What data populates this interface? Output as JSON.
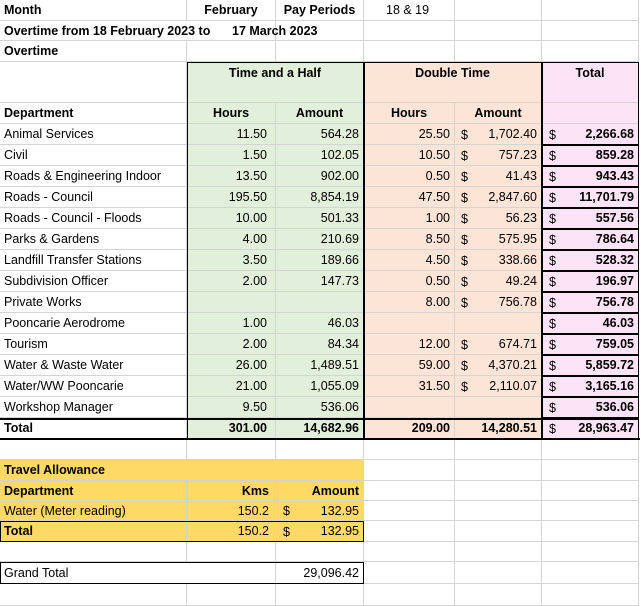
{
  "header": {
    "month_label": "Month",
    "month_value": "February",
    "pay_periods_label": "Pay Periods",
    "pay_periods_value": "18 & 19",
    "overtime_range_label": "Overtime from 18 February 2023 to",
    "overtime_range_end": "17 March 2023",
    "section_title": "Overtime"
  },
  "columns": {
    "time_and_half": "Time and a Half",
    "double_time": "Double Time",
    "total": "Total",
    "department": "Department",
    "hours": "Hours",
    "amount": "Amount",
    "currency": "$"
  },
  "rows": [
    {
      "dept": "Animal Services",
      "th_hours": "11.50",
      "th_amount": "564.28",
      "dt_hours": "25.50",
      "dt_amount": "1,702.40",
      "total": "2,266.68"
    },
    {
      "dept": "Civil",
      "th_hours": "1.50",
      "th_amount": "102.05",
      "dt_hours": "10.50",
      "dt_amount": "757.23",
      "total": "859.28"
    },
    {
      "dept": "Roads & Engineering Indoor",
      "th_hours": "13.50",
      "th_amount": "902.00",
      "dt_hours": "0.50",
      "dt_amount": "41.43",
      "total": "943.43"
    },
    {
      "dept": "Roads - Council",
      "th_hours": "195.50",
      "th_amount": "8,854.19",
      "dt_hours": "47.50",
      "dt_amount": "2,847.60",
      "total": "11,701.79"
    },
    {
      "dept": "Roads - Council - Floods",
      "th_hours": "10.00",
      "th_amount": "501.33",
      "dt_hours": "1.00",
      "dt_amount": "56.23",
      "total": "557.56"
    },
    {
      "dept": "Parks & Gardens",
      "th_hours": "4.00",
      "th_amount": "210.69",
      "dt_hours": "8.50",
      "dt_amount": "575.95",
      "total": "786.64"
    },
    {
      "dept": "Landfill Transfer Stations",
      "th_hours": "3.50",
      "th_amount": "189.66",
      "dt_hours": "4.50",
      "dt_amount": "338.66",
      "total": "528.32"
    },
    {
      "dept": "Subdivision Officer",
      "th_hours": "2.00",
      "th_amount": "147.73",
      "dt_hours": "0.50",
      "dt_amount": "49.24",
      "total": "196.97"
    },
    {
      "dept": "Private Works",
      "th_hours": "",
      "th_amount": "",
      "dt_hours": "8.00",
      "dt_amount": "756.78",
      "total": "756.78"
    },
    {
      "dept": "Pooncarie Aerodrome",
      "th_hours": "1.00",
      "th_amount": "46.03",
      "dt_hours": "",
      "dt_amount": "",
      "total": "46.03"
    },
    {
      "dept": "Tourism",
      "th_hours": "2.00",
      "th_amount": "84.34",
      "dt_hours": "12.00",
      "dt_amount": "674.71",
      "total": "759.05"
    },
    {
      "dept": "Water & Waste Water",
      "th_hours": "26.00",
      "th_amount": "1,489.51",
      "dt_hours": "59.00",
      "dt_amount": "4,370.21",
      "total": "5,859.72"
    },
    {
      "dept": "Water/WW Pooncarie",
      "th_hours": "21.00",
      "th_amount": "1,055.09",
      "dt_hours": "31.50",
      "dt_amount": "2,110.07",
      "total": "3,165.16"
    },
    {
      "dept": "Workshop Manager",
      "th_hours": "9.50",
      "th_amount": "536.06",
      "dt_hours": "",
      "dt_amount": "",
      "total": "536.06"
    }
  ],
  "totals": {
    "label": "Total",
    "th_hours": "301.00",
    "th_amount": "14,682.96",
    "dt_hours": "209.00",
    "dt_amount": "14,280.51",
    "total": "28,963.47"
  },
  "travel": {
    "title": "Travel Allowance",
    "dept_label": "Department",
    "kms_label": "Kms",
    "amount_label": "Amount",
    "row_dept": "Water (Meter reading)",
    "row_kms": "150.2",
    "row_amount": "132.95",
    "total_label": "Total",
    "total_kms": "150.2",
    "total_amount": "132.95"
  },
  "grand_total": {
    "label": "Grand Total",
    "value": "29,096.42"
  }
}
